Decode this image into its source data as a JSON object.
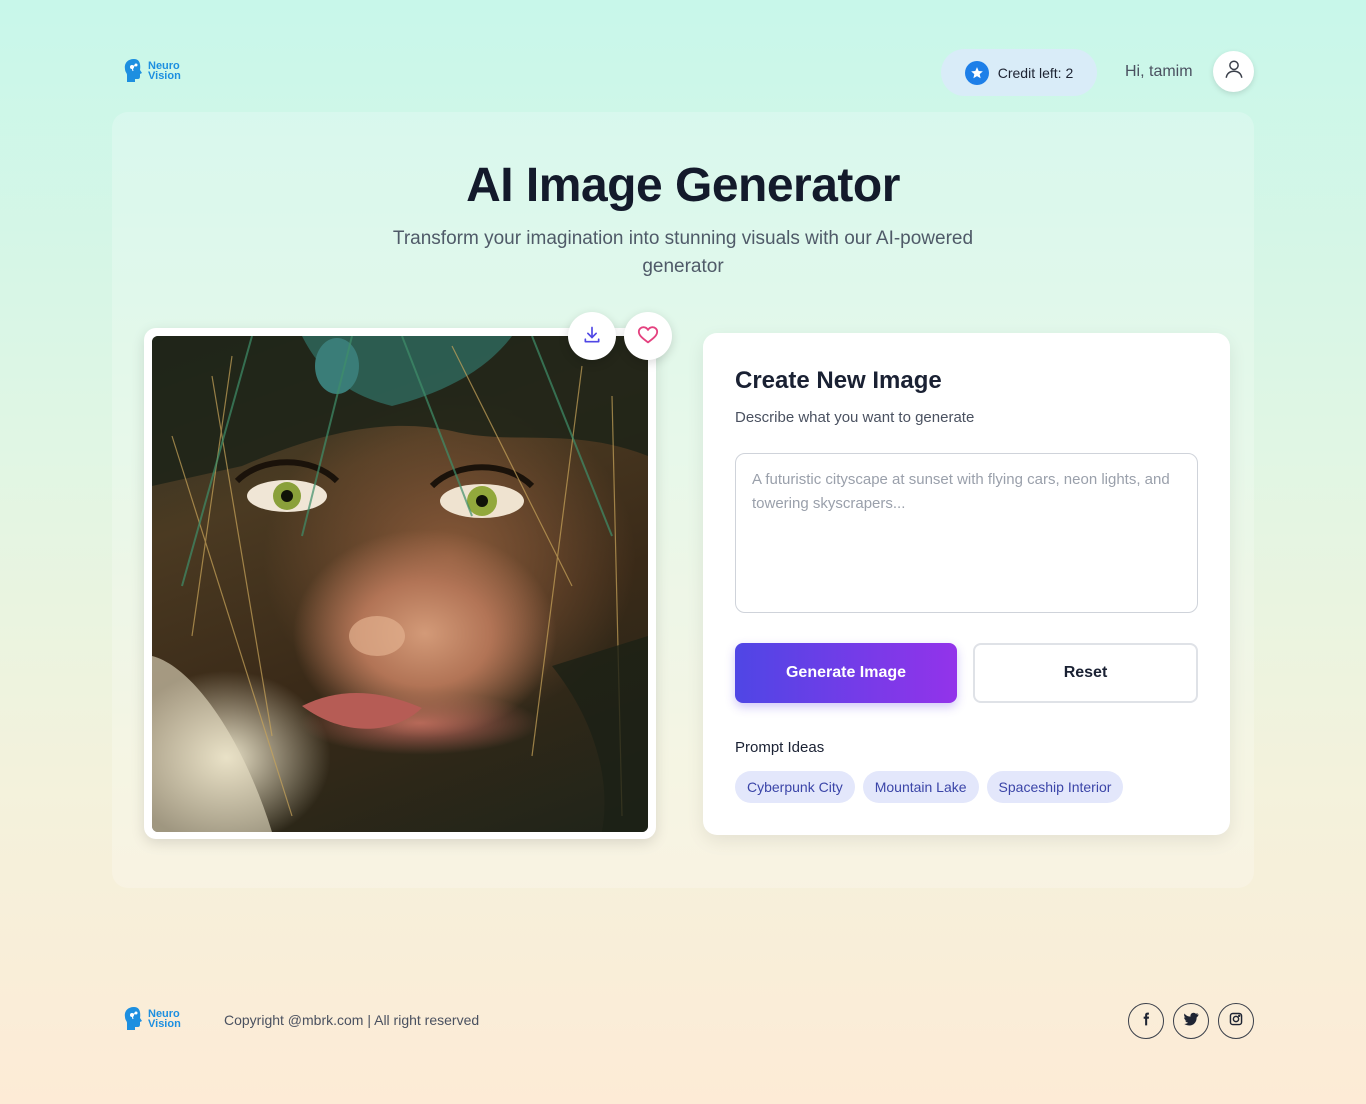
{
  "brand": {
    "line1": "Neuro",
    "line2": "Vision"
  },
  "header": {
    "credit_label": "Credit left: 2",
    "greeting": "Hi, tamim"
  },
  "hero": {
    "title": "AI Image Generator",
    "subtitle": "Transform your imagination into stunning visuals with our AI-powered generator"
  },
  "image_actions": {
    "download_icon": "download-icon",
    "favorite_icon": "heart-icon"
  },
  "create": {
    "title": "Create New Image",
    "description": "Describe what you want to generate",
    "prompt_placeholder": "A futuristic cityscape at sunset with flying cars, neon lights, and towering skyscrapers...",
    "generate_label": "Generate Image",
    "reset_label": "Reset",
    "ideas_label": "Prompt Ideas",
    "ideas": [
      "Cyberpunk City",
      "Mountain Lake",
      "Spaceship Interior"
    ]
  },
  "footer": {
    "copyright": "Copyright @mbrk.com | All right reserved",
    "social": [
      "facebook-icon",
      "twitter-icon",
      "instagram-icon"
    ]
  },
  "colors": {
    "accent_start": "#4f46e5",
    "accent_end": "#9333ea",
    "brand_blue": "#1d8fe0",
    "chip_bg": "#e3e7fb"
  }
}
